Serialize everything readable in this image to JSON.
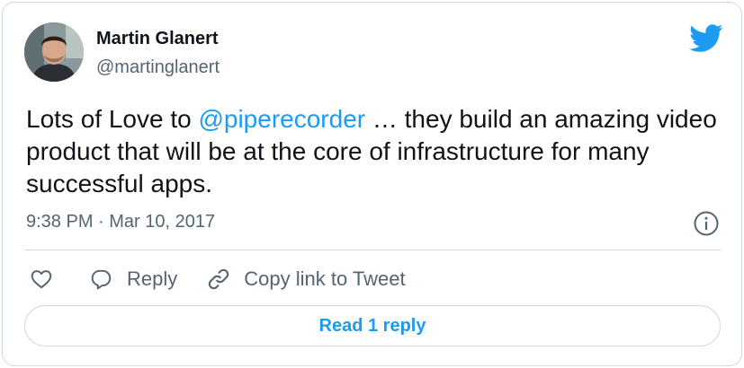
{
  "author": {
    "name": "Martin Glanert",
    "handle": "@martinglanert"
  },
  "tweet": {
    "text_before": "Lots of Love to ",
    "mention": "@piperecorder",
    "text_after": " … they build an amazing video product that will be at the core of infrastructure for many successful apps.",
    "timestamp": "9:38 PM · Mar 10, 2017"
  },
  "actions": {
    "reply_label": "Reply",
    "copy_link_label": "Copy link to Tweet"
  },
  "read_replies_label": "Read 1 reply",
  "icons": {
    "brand": "twitter-bird-icon",
    "info": "info-icon",
    "like": "heart-icon",
    "reply": "speech-bubble-icon",
    "copy_link": "link-icon"
  },
  "colors": {
    "accent": "#1d9bf0",
    "text": "#0f1419",
    "secondary": "#536471",
    "border": "#cfd9de"
  }
}
